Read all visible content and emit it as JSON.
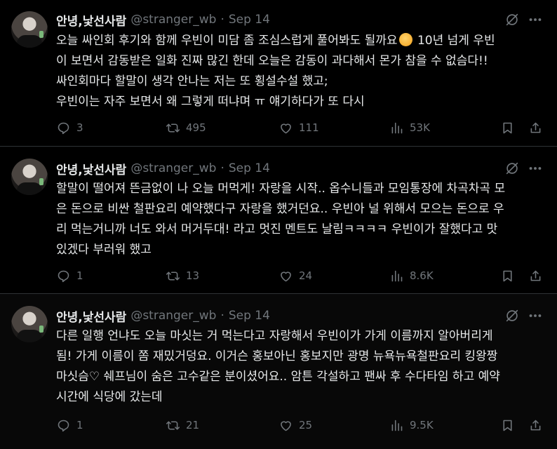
{
  "tweets": [
    {
      "name": "안녕,낯선사람",
      "handle": "@stranger_wb",
      "separator": "·",
      "date": "Sep 14",
      "text_before_emoji": "오늘 싸인회 후기와 함께 우빈이 미담 좀 조심스럽게 풀어봐도 될까요",
      "emoji": "shushing-face-emoji",
      "text_after_emoji": " 10년 넘게 우빈\n이 보면서 감동받은 일화 진짜 많긴 한데 오늘은 감동이 과다해서 몬가 참을 수 없슴다!!\n싸인회마다 할말이 생각 안나는 저는 또 횡설수설 했고;\n우빈이는 자주 보면서 왜 그렇게 떠냐며 ㅠ 얘기하다가 또 다시",
      "replies": "3",
      "retweets": "495",
      "likes": "111",
      "views": "53K"
    },
    {
      "name": "안녕,낯선사람",
      "handle": "@stranger_wb",
      "separator": "·",
      "date": "Sep 14",
      "text": "할말이 떨어져 뜬금없이 나 오늘 머먹게! 자랑을 시작.. 옵수니들과 모임통장에 차곡차곡 모\n은 돈으로 비싼 철판요리 예약했다구 자랑을 했거던요.. 우빈아 널 위해서 모으는 돈으로 우\n리 먹는거니까 너도 와서 머거두대! 라고 멋진 멘트도 날림ㅋㅋㅋㅋ 우빈이가 잘했다고 맛\n있겠다 부러워 했고",
      "replies": "1",
      "retweets": "13",
      "likes": "24",
      "views": "8.6K"
    },
    {
      "name": "안녕,낯선사람",
      "handle": "@stranger_wb",
      "separator": "·",
      "date": "Sep 14",
      "text": "다른 일행 언냐도 오늘 마싯는 거 먹는다고 자랑해서 우빈이가 가게 이름까지 알아버리게\n됨! 가게 이름이 쫌 재밌거덩요. 이거슨 홍보아닌 홍보지만 광명 뉴욕뉴욕철판요리 킹왕짱\n마싯슴♡ 쉐프님이 숨은 고수같은 분이셨어요.. 암튼 각설하고 팬싸 후 수다타임 하고 예약\n시간에 식당에 갔는데",
      "replies": "1",
      "retweets": "21",
      "likes": "25",
      "views": "9.5K"
    }
  ],
  "colors": {
    "background": "#000000",
    "text": "#e7e9ea",
    "muted": "#71767b",
    "divider": "#2f3336"
  }
}
